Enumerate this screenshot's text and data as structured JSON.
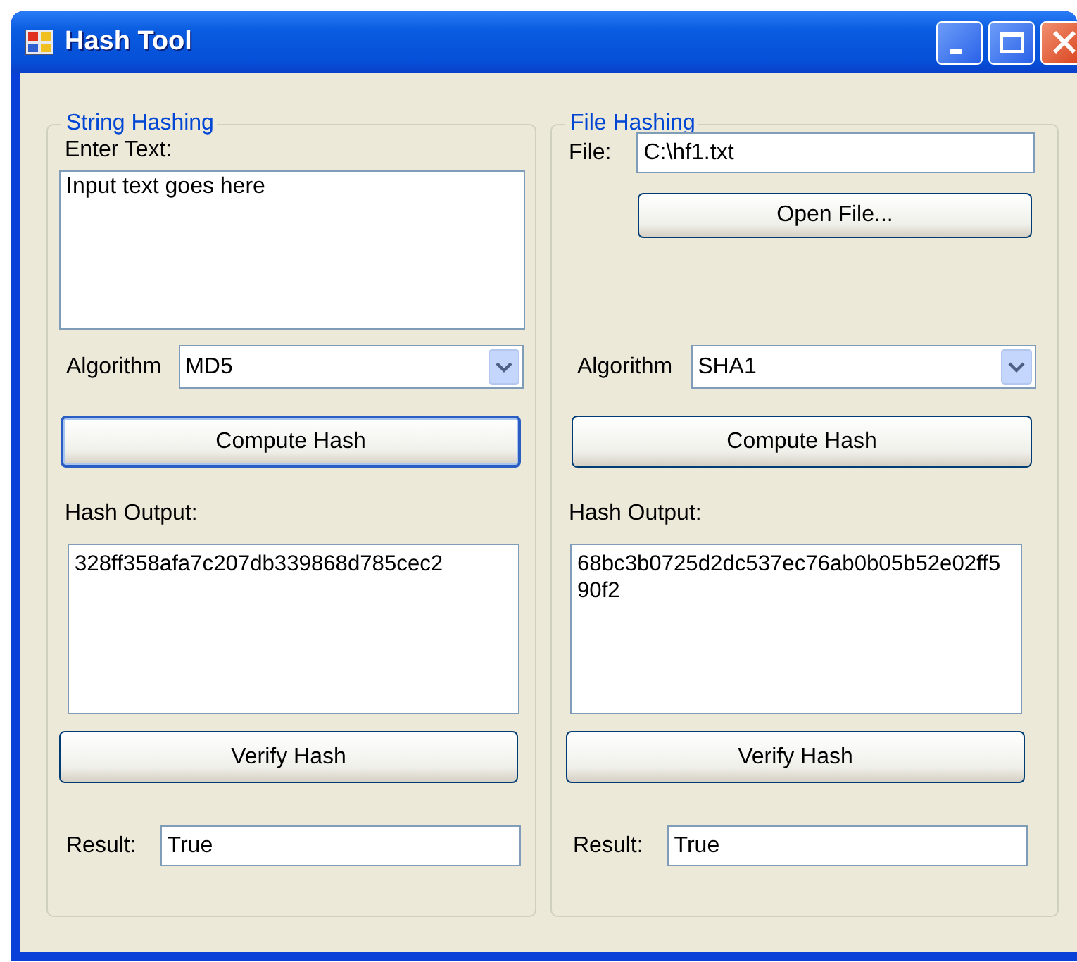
{
  "window": {
    "title": "Hash Tool"
  },
  "string_hashing": {
    "title": "String Hashing",
    "input_label": "Enter Text:",
    "input": "Input text goes here",
    "algorithm_label": "Algorithm",
    "algorithm": "MD5",
    "compute_button": {
      "label": "Compute Hash",
      "focused": true
    },
    "output_label": "Hash Output:",
    "output": "328ff358afa7c207db339868d785cec2",
    "verify_button": "Verify Hash",
    "result_label": "Result:",
    "result": "True"
  },
  "file_hashing": {
    "title": "File Hashing",
    "file_label": "File:",
    "file": "C:\\hf1.txt",
    "open_button": "Open File...",
    "algorithm_label": "Algorithm",
    "algorithm": "SHA1",
    "compute_button": {
      "label": "Compute Hash",
      "focused": false
    },
    "output_label": "Hash Output:",
    "output": "68bc3b0725d2dc537ec76ab0b05b52e02ff590f2",
    "verify_button": "Verify Hash",
    "result_label": "Result:",
    "result": "True"
  }
}
